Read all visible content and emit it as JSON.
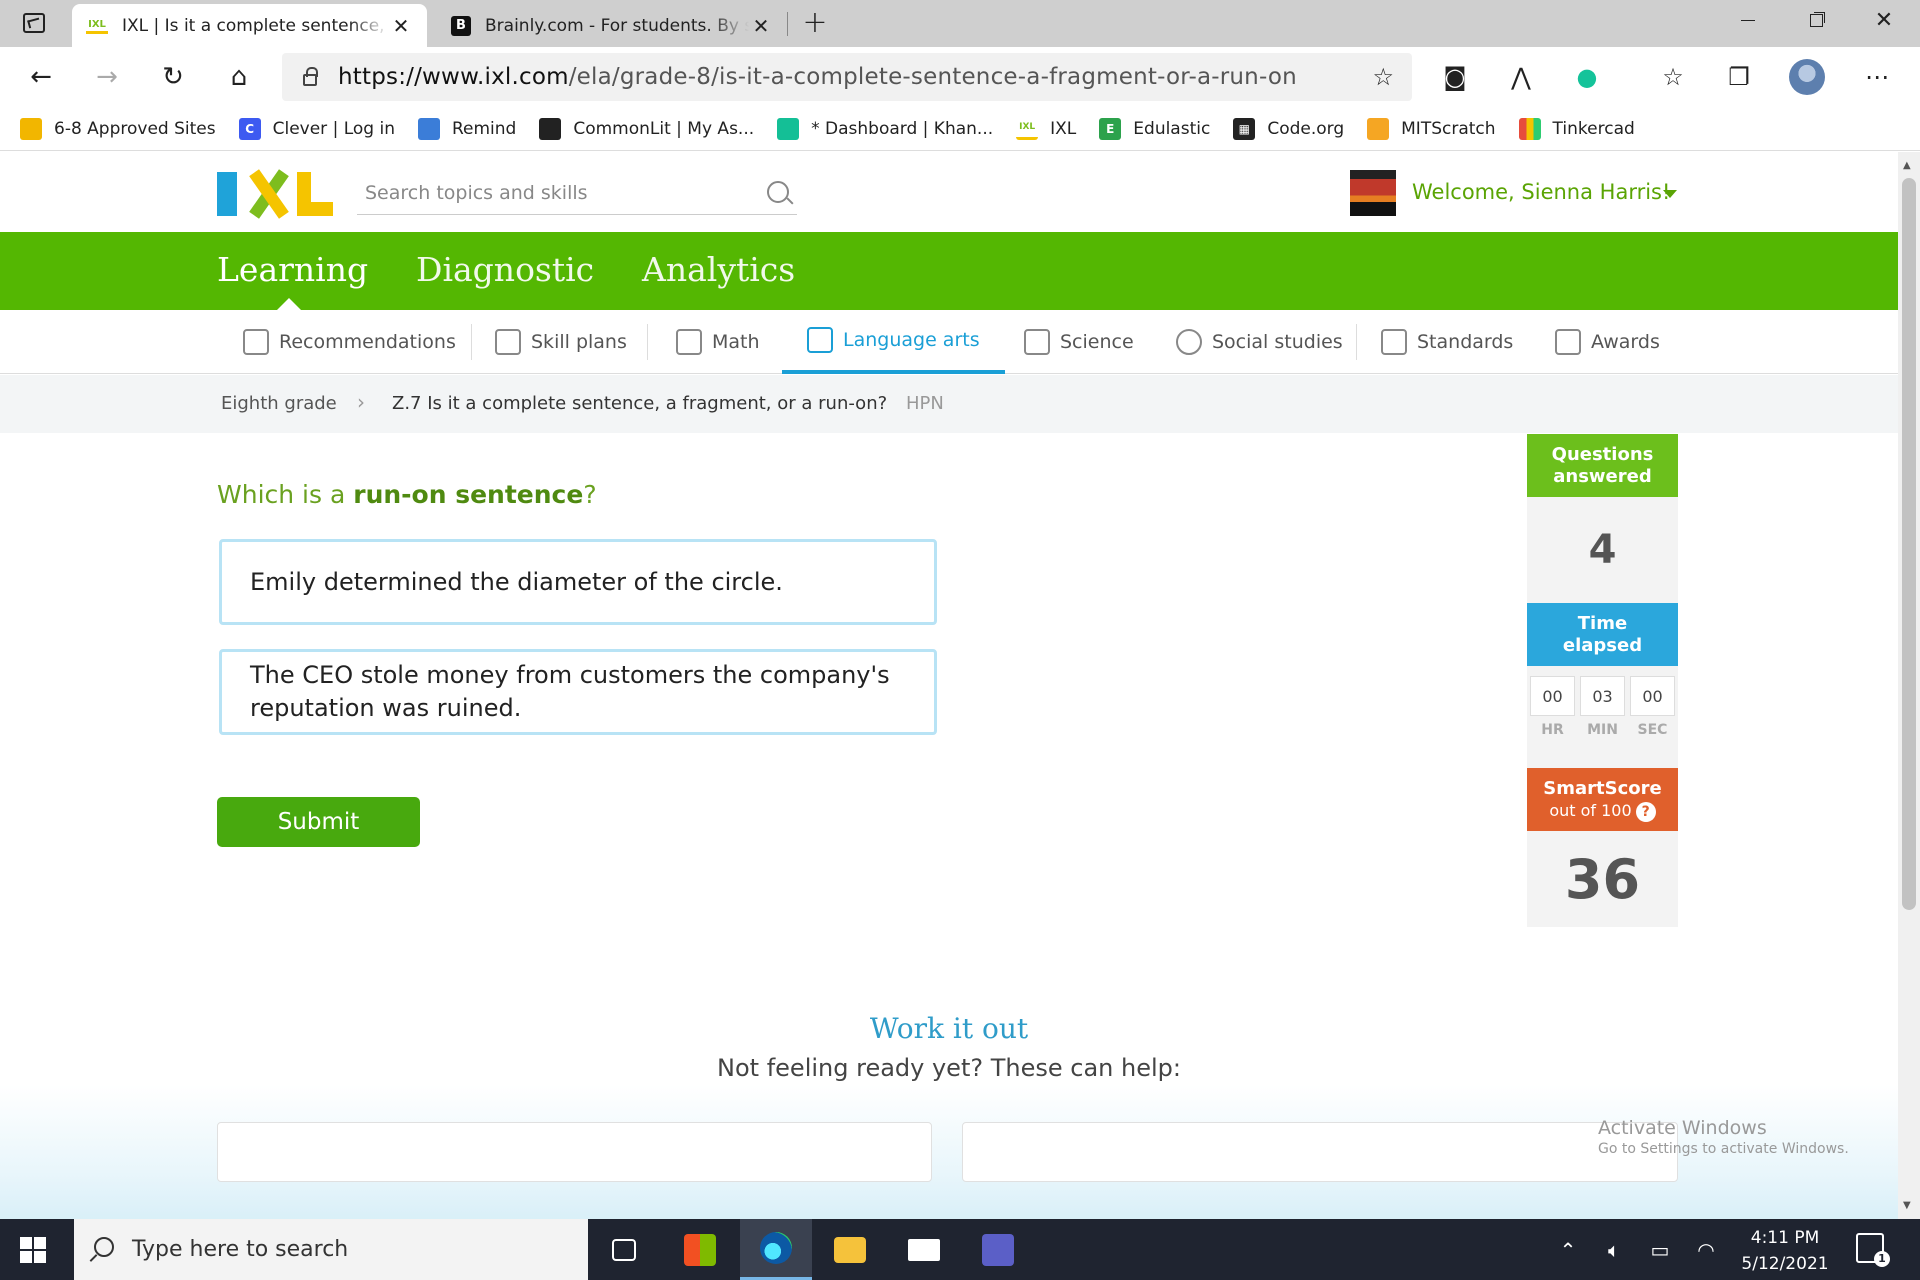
{
  "browser": {
    "tabs": [
      {
        "title": "IXL | Is it a complete sentence, a fragment, or a run-on",
        "favicon": "ixl-favicon"
      },
      {
        "title": "Brainly.com - For students. By students.",
        "favicon": "brainly-favicon"
      }
    ],
    "url_host": "https://www.ixl.com",
    "url_path": "/ela/grade-8/is-it-a-complete-sentence-a-fragment-or-a-run-on",
    "bookmarks": [
      {
        "label": "6-8 Approved Sites",
        "color": "#f2b600"
      },
      {
        "label": "Clever | Log in",
        "color": "#3d5af1"
      },
      {
        "label": "Remind",
        "color": "#3b7dd8"
      },
      {
        "label": "CommonLit | My As...",
        "color": "#222222"
      },
      {
        "label": "* Dashboard | Khan...",
        "color": "#14bf96"
      },
      {
        "label": "IXL",
        "color": "#7dbd1e"
      },
      {
        "label": "Edulastic",
        "color": "#2ca24c"
      },
      {
        "label": "Code.org",
        "color": "#222222"
      },
      {
        "label": "MITScratch",
        "color": "#f5a623"
      },
      {
        "label": "Tinkercad",
        "color": "#e74c3c"
      }
    ]
  },
  "ixl": {
    "search_placeholder": "Search topics and skills",
    "welcome": "Welcome, Sienna Harris!",
    "main_nav": [
      "Learning",
      "Diagnostic",
      "Analytics"
    ],
    "sub_nav": [
      "Recommendations",
      "Skill plans",
      "Math",
      "Language arts",
      "Science",
      "Social studies",
      "Standards",
      "Awards"
    ],
    "breadcrumb": {
      "grade": "Eighth grade",
      "skill": "Z.7 Is it a complete sentence, a fragment, or a run-on?",
      "code": "HPN"
    },
    "question": {
      "prefix": "Which is a ",
      "emphasis": "run-on sentence",
      "suffix": "?"
    },
    "choices": [
      "Emily determined the diameter of the circle.",
      "The CEO stole money from customers the company's reputation was ruined."
    ],
    "submit_label": "Submit",
    "sidebar": {
      "questions_label_1": "Questions",
      "questions_label_2": "answered",
      "questions_value": "4",
      "time_label_1": "Time",
      "time_label_2": "elapsed",
      "time": {
        "hr": "00",
        "min": "03",
        "sec": "00"
      },
      "time_units": {
        "hr": "HR",
        "min": "MIN",
        "sec": "SEC"
      },
      "smartscore_label": "SmartScore",
      "smartscore_sub": "out of 100",
      "smartscore_help": "?",
      "smartscore_value": "36"
    },
    "work_it_out": {
      "title": "Work it out",
      "subtitle": "Not feeling ready yet? These can help:"
    },
    "activate_windows": {
      "line1": "Activate Windows",
      "line2": "Go to Settings to activate Windows."
    }
  },
  "taskbar": {
    "search_placeholder": "Type here to search",
    "time": "4:11 PM",
    "date": "5/12/2021",
    "notification_count": "1"
  }
}
